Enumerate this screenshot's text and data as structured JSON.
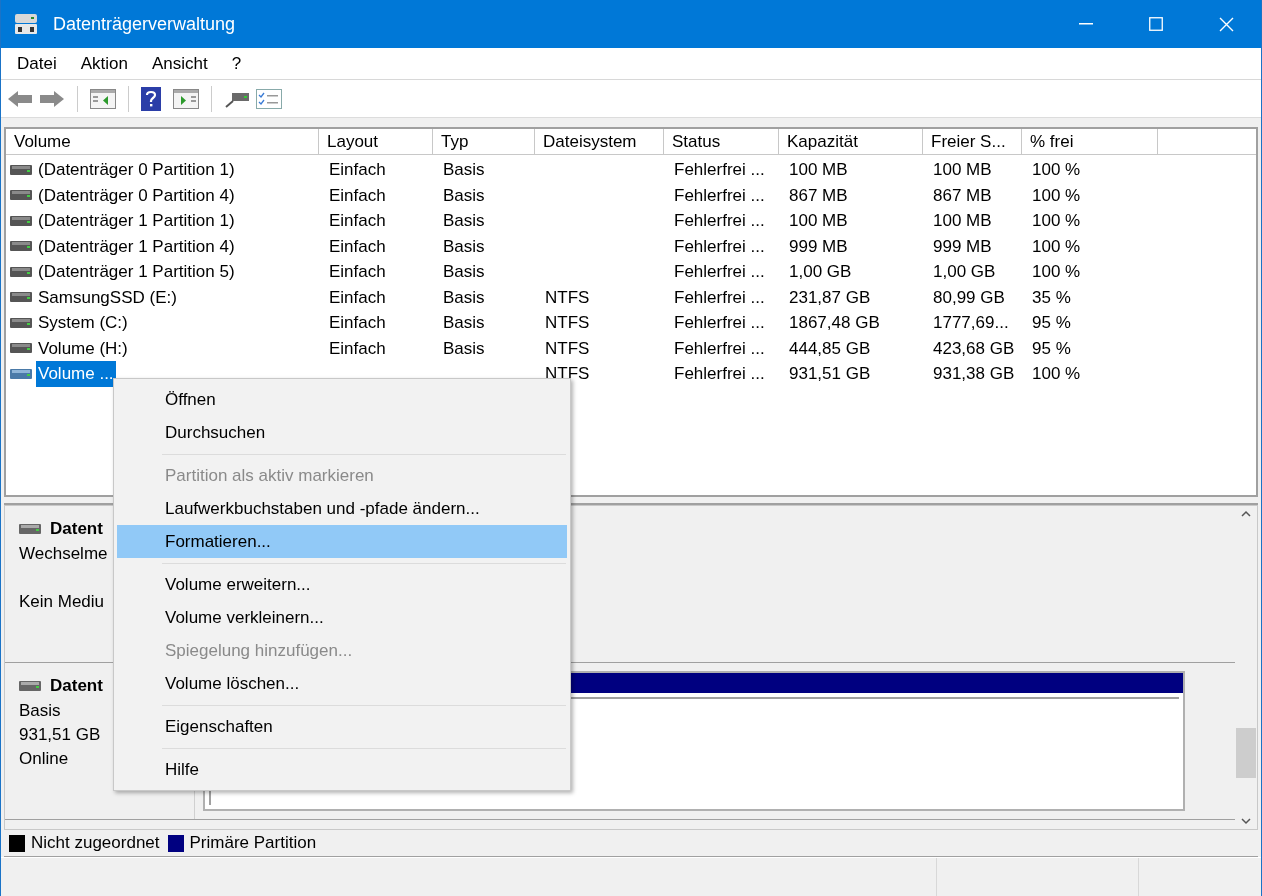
{
  "window": {
    "title": "Datenträgerverwaltung"
  },
  "menu": [
    "Datei",
    "Aktion",
    "Ansicht",
    "?"
  ],
  "volume_table": {
    "columns": [
      "Volume",
      "Layout",
      "Typ",
      "Dateisystem",
      "Status",
      "Kapazität",
      "Freier S...",
      "% frei"
    ],
    "rows": [
      {
        "selected": false,
        "cells": [
          "(Datenträger 0 Partition 1)",
          "Einfach",
          "Basis",
          "",
          "Fehlerfrei ...",
          "100 MB",
          "100 MB",
          "100 %"
        ]
      },
      {
        "selected": false,
        "cells": [
          "(Datenträger 0 Partition 4)",
          "Einfach",
          "Basis",
          "",
          "Fehlerfrei ...",
          "867 MB",
          "867 MB",
          "100 %"
        ]
      },
      {
        "selected": false,
        "cells": [
          "(Datenträger 1 Partition 1)",
          "Einfach",
          "Basis",
          "",
          "Fehlerfrei ...",
          "100 MB",
          "100 MB",
          "100 %"
        ]
      },
      {
        "selected": false,
        "cells": [
          "(Datenträger 1 Partition 4)",
          "Einfach",
          "Basis",
          "",
          "Fehlerfrei ...",
          "999 MB",
          "999 MB",
          "100 %"
        ]
      },
      {
        "selected": false,
        "cells": [
          "(Datenträger 1 Partition 5)",
          "Einfach",
          "Basis",
          "",
          "Fehlerfrei ...",
          "1,00 GB",
          "1,00 GB",
          "100 %"
        ]
      },
      {
        "selected": false,
        "cells": [
          "SamsungSSD (E:)",
          "Einfach",
          "Basis",
          "NTFS",
          "Fehlerfrei ...",
          "231,87 GB",
          "80,99 GB",
          "35 %"
        ]
      },
      {
        "selected": false,
        "cells": [
          "System (C:)",
          "Einfach",
          "Basis",
          "NTFS",
          "Fehlerfrei ...",
          "1867,48 GB",
          "1777,69...",
          "95 %"
        ]
      },
      {
        "selected": false,
        "cells": [
          "Volume (H:)",
          "Einfach",
          "Basis",
          "NTFS",
          "Fehlerfrei ...",
          "444,85 GB",
          "423,68 GB",
          "95 %"
        ]
      },
      {
        "selected": true,
        "cells": [
          "Volume ...",
          "",
          "",
          "NTFS",
          "Fehlerfrei ...",
          "931,51 GB",
          "931,38 GB",
          "100 %"
        ]
      }
    ]
  },
  "disks": [
    {
      "name": "Datent",
      "type": "Wechselme",
      "status": "Kein Mediu"
    },
    {
      "name": "Datent",
      "type": "Basis",
      "size": "931,51 GB",
      "status": "Online",
      "partitions": [
        {
          "color": "#000080"
        }
      ]
    }
  ],
  "legend": [
    {
      "label": "Nicht zugeordnet",
      "color": "#000000"
    },
    {
      "label": "Primäre Partition",
      "color": "#000080"
    }
  ],
  "context_menu": [
    {
      "kind": "item",
      "label": "Öffnen",
      "disabled": false,
      "selected": false
    },
    {
      "kind": "item",
      "label": "Durchsuchen",
      "disabled": false,
      "selected": false
    },
    {
      "kind": "separator"
    },
    {
      "kind": "item",
      "label": "Partition als aktiv markieren",
      "disabled": true,
      "selected": false
    },
    {
      "kind": "item",
      "label": "Laufwerkbuchstaben und -pfade ändern...",
      "disabled": false,
      "selected": false
    },
    {
      "kind": "item",
      "label": "Formatieren...",
      "disabled": false,
      "selected": true
    },
    {
      "kind": "separator"
    },
    {
      "kind": "item",
      "label": "Volume erweitern...",
      "disabled": false,
      "selected": false
    },
    {
      "kind": "item",
      "label": "Volume verkleinern...",
      "disabled": false,
      "selected": false
    },
    {
      "kind": "item",
      "label": "Spiegelung hinzufügen...",
      "disabled": true,
      "selected": false
    },
    {
      "kind": "item",
      "label": "Volume löschen...",
      "disabled": false,
      "selected": false
    },
    {
      "kind": "separator"
    },
    {
      "kind": "item",
      "label": "Eigenschaften",
      "disabled": false,
      "selected": false
    },
    {
      "kind": "separator"
    },
    {
      "kind": "item",
      "label": "Hilfe",
      "disabled": false,
      "selected": false
    }
  ]
}
